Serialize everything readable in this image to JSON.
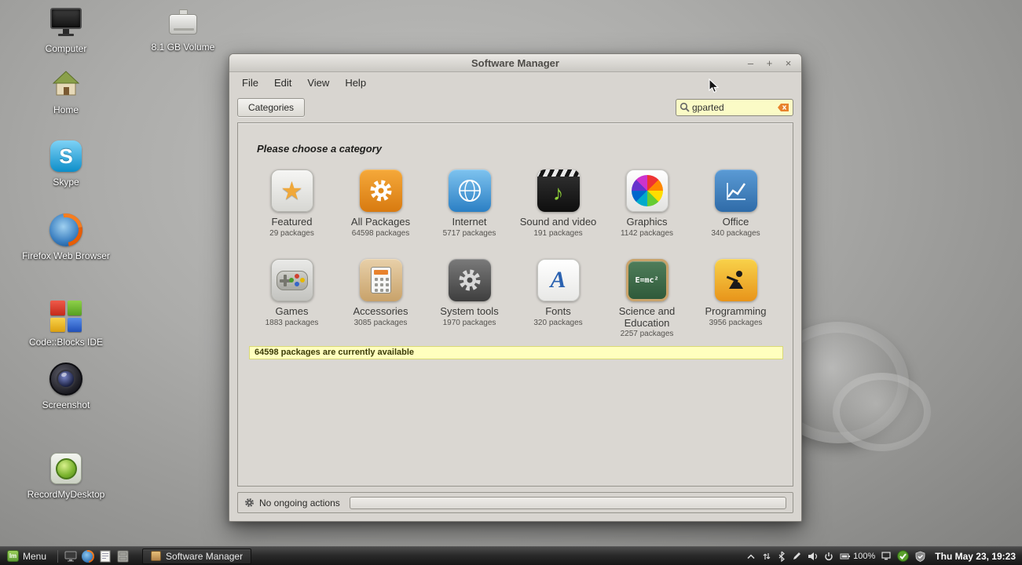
{
  "desktop": {
    "icons": [
      {
        "label": "Computer"
      },
      {
        "label": "8.1 GB Volume"
      },
      {
        "label": "Home"
      },
      {
        "label": "Skype",
        "glyph": "S"
      },
      {
        "label": "Firefox Web Browser"
      },
      {
        "label": "Code::Blocks IDE"
      },
      {
        "label": "Screenshot"
      },
      {
        "label": "RecordMyDesktop"
      }
    ]
  },
  "window": {
    "title": "Software Manager",
    "controls": {
      "minimize": "–",
      "maximize": "+",
      "close": "×"
    },
    "menus": [
      {
        "label": "File"
      },
      {
        "label": "Edit"
      },
      {
        "label": "View"
      },
      {
        "label": "Help"
      }
    ],
    "toolbar": {
      "categories_label": "Categories",
      "search_value": "gparted"
    },
    "content": {
      "heading": "Please choose a category",
      "categories": [
        {
          "label": "Featured",
          "count": "29 packages",
          "glyph": "★"
        },
        {
          "label": "All Packages",
          "count": "64598 packages"
        },
        {
          "label": "Internet",
          "count": "5717 packages"
        },
        {
          "label": "Sound and video",
          "count": "191 packages",
          "glyph": "♪"
        },
        {
          "label": "Graphics",
          "count": "1142 packages"
        },
        {
          "label": "Office",
          "count": "340 packages"
        },
        {
          "label": "Games",
          "count": "1883 packages"
        },
        {
          "label": "Accessories",
          "count": "3085 packages"
        },
        {
          "label": "System tools",
          "count": "1970 packages"
        },
        {
          "label": "Fonts",
          "count": "320 packages",
          "glyph": "A"
        },
        {
          "label": "Science and Education",
          "count": "2257 packages",
          "glyph": "E=mc²"
        },
        {
          "label": "Programming",
          "count": "3956 packages"
        }
      ],
      "info_banner": "64598 packages are currently available"
    },
    "statusbar": {
      "text": "No ongoing actions"
    }
  },
  "taskbar": {
    "menu_logo": "lm",
    "menu_label": "Menu",
    "task_button": "Software Manager",
    "battery": "100%",
    "clock": "Thu May 23, 19:23"
  }
}
